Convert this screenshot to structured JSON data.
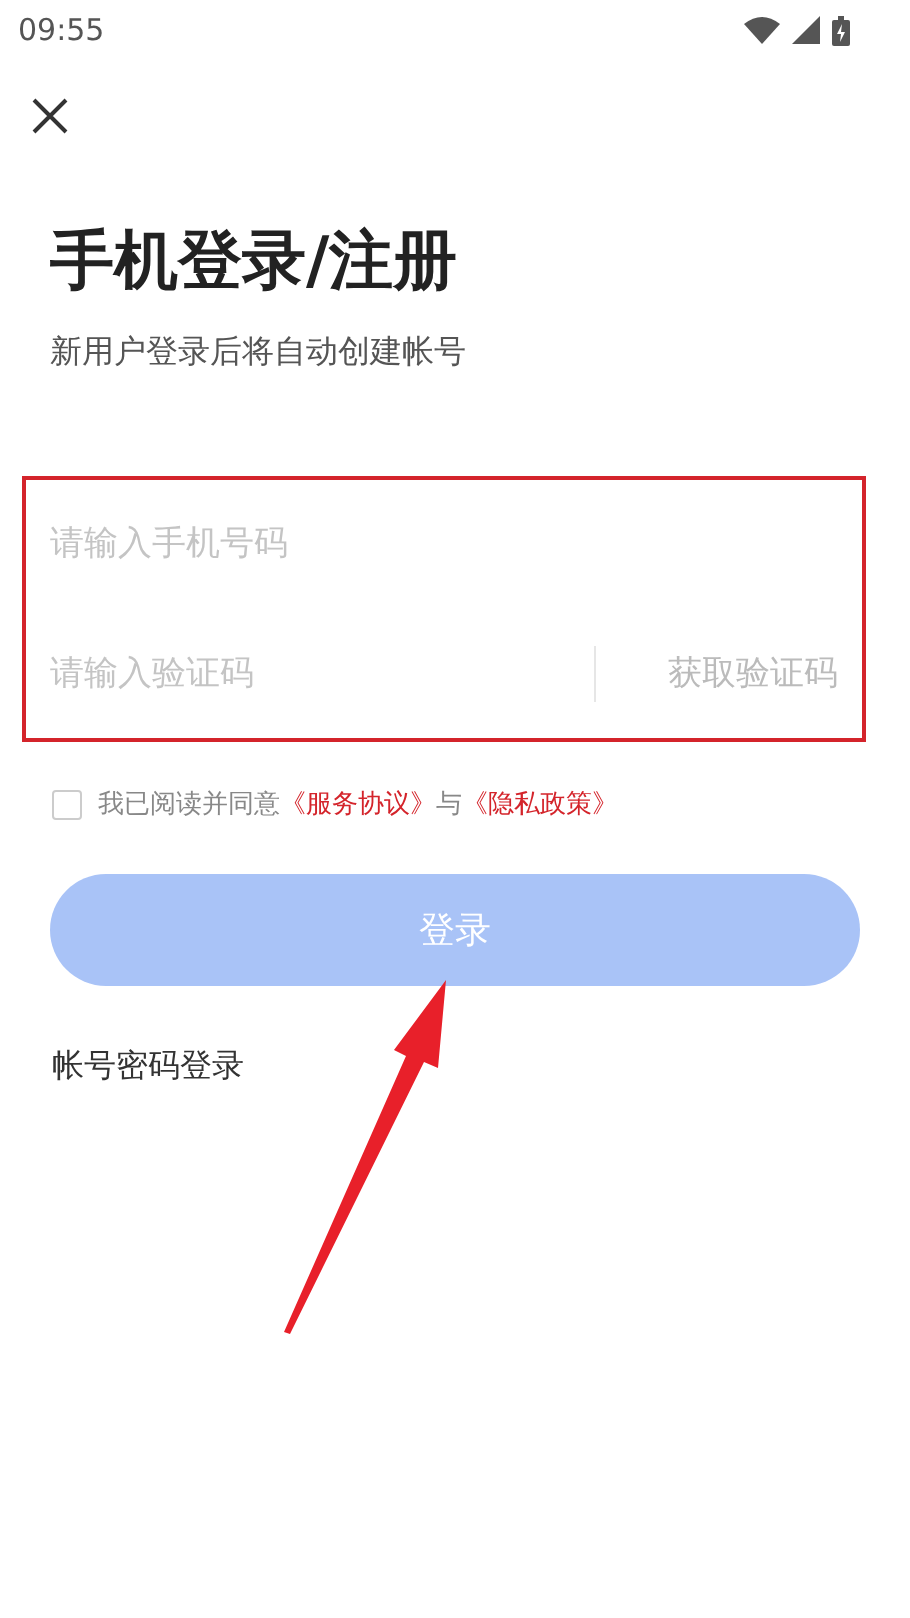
{
  "status_bar": {
    "time": "09:55"
  },
  "title": "手机登录/注册",
  "subtitle": "新用户登录后将自动创建帐号",
  "fields": [
    {
      "kind": "phone",
      "placeholder": "请输入手机号码"
    },
    {
      "kind": "code",
      "placeholder": "请输入验证码",
      "action": "获取验证码"
    }
  ],
  "consent": {
    "checked": false,
    "parts": [
      {
        "kind": "text",
        "text": "我已阅读并同意"
      },
      {
        "kind": "link",
        "text": "《服务协议》"
      },
      {
        "kind": "text",
        "text": "与"
      },
      {
        "kind": "link",
        "text": "《隐私政策》"
      }
    ]
  },
  "login_button": {
    "label": "登录",
    "disabled": true
  },
  "alt_login": "帐号密码登录"
}
